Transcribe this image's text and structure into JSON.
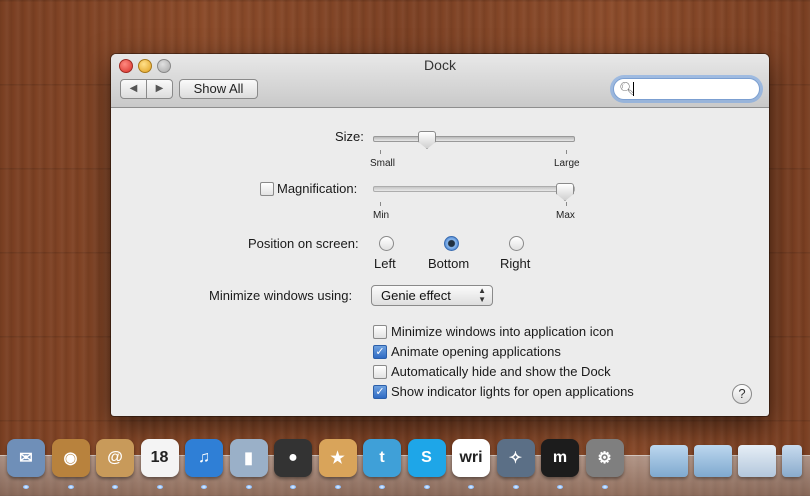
{
  "window": {
    "title": "Dock",
    "nav_back": "◀",
    "nav_forward": "▶",
    "show_all": "Show All",
    "search_value": ""
  },
  "size": {
    "label": "Size:",
    "min_label": "Small",
    "max_label": "Large",
    "value_fraction": 0.25
  },
  "magnification": {
    "label": "Magnification:",
    "checked": false,
    "min_label": "Min",
    "max_label": "Max",
    "value_fraction": 1.0
  },
  "position": {
    "label": "Position on screen:",
    "options": [
      "Left",
      "Bottom",
      "Right"
    ],
    "selected": "Bottom"
  },
  "minimize": {
    "label": "Minimize windows using:",
    "value": "Genie effect"
  },
  "options": [
    {
      "label": "Minimize windows into application icon",
      "checked": false
    },
    {
      "label": "Animate opening applications",
      "checked": true
    },
    {
      "label": "Automatically hide and show the Dock",
      "checked": false
    },
    {
      "label": "Show indicator lights for open applications",
      "checked": true
    }
  ],
  "help_label": "?",
  "dock": {
    "apps": [
      {
        "icon": "mail-stamp-icon",
        "color": "#6f8fb8",
        "glyph": "✉"
      },
      {
        "icon": "photo-booth-icon",
        "color": "#b8823d",
        "glyph": "◉"
      },
      {
        "icon": "address-book-icon",
        "color": "#c89a5a",
        "glyph": "@"
      },
      {
        "icon": "calendar-icon",
        "color": "#f4f4f4",
        "glyph": "18"
      },
      {
        "icon": "itunes-icon",
        "color": "#2f7fd6",
        "glyph": "♫"
      },
      {
        "icon": "system-monitor-icon",
        "color": "#9ab0c8",
        "glyph": "▮"
      },
      {
        "icon": "facetime-camera-icon",
        "color": "#333333",
        "glyph": "●"
      },
      {
        "icon": "package-icon",
        "color": "#d9a45a",
        "glyph": "★"
      },
      {
        "icon": "twitter-icon",
        "color": "#3fa0d8",
        "glyph": "t"
      },
      {
        "icon": "skype-icon",
        "color": "#1ea6e8",
        "glyph": "S"
      },
      {
        "icon": "writer-icon",
        "color": "#ffffff",
        "glyph": "wri"
      },
      {
        "icon": "compass-icon",
        "color": "#5b6f86",
        "glyph": "✧"
      },
      {
        "icon": "m-app-icon",
        "color": "#1c1c1c",
        "glyph": "m"
      },
      {
        "icon": "system-preferences-icon",
        "color": "#7f7f7f",
        "glyph": "⚙"
      }
    ],
    "stack_icons": [
      "folder-icon",
      "folder-icon",
      "document-icon",
      "globe-icon"
    ]
  }
}
